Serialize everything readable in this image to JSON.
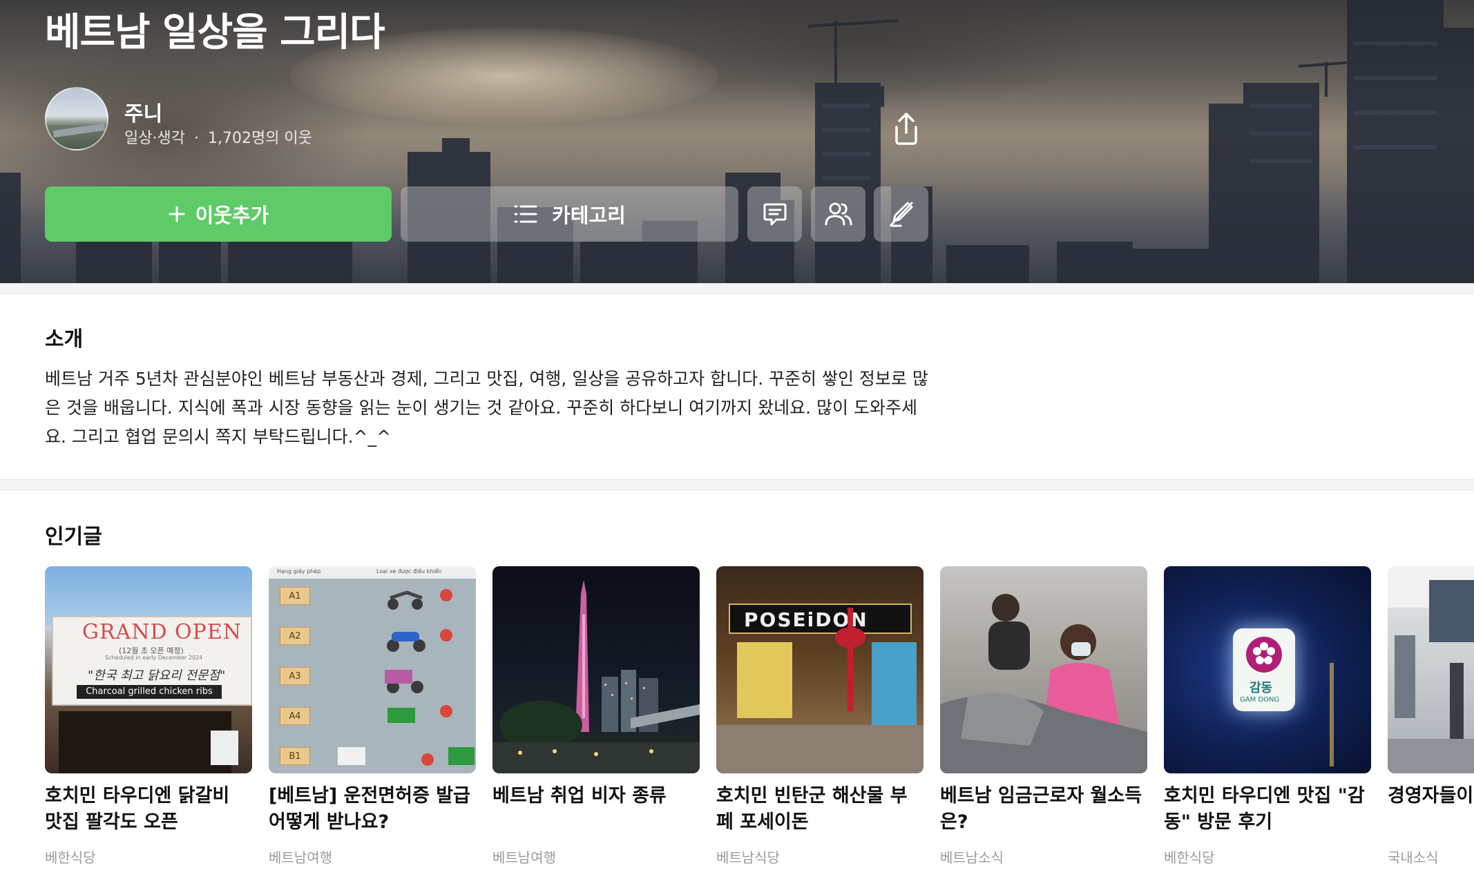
{
  "blog": {
    "title": "베트남 일상을 그리다",
    "nickname": "주니",
    "category": "일상·생각",
    "neighbors": "1,702명의 이웃",
    "meta_sep": "·"
  },
  "actions": {
    "add_neighbor_label": "이웃추가",
    "category_label": "카테고리"
  },
  "intro": {
    "heading": "소개",
    "text": "베트남 거주 5년차 관심분야인 베트남 부동산과 경제, 그리고 맛집, 여행, 일상을 공유하고자 합니다. 꾸준히 쌓인 정보로 많은 것을 배웁니다. 지식에 폭과 시장 동향을 읽는 눈이 생기는 것 같아요. 꾸준히 하다보니 여기까지 왔네요. 많이 도와주세요. 그리고 협업 문의시 쪽지 부탁드립니다.^_^"
  },
  "popular": {
    "heading": "인기글",
    "posts": [
      {
        "title": "호치민 타우디엔 닭갈비 맛집 팔각도 오픈",
        "category": "베한식당",
        "thumb": {
          "banner_main": "GRAND OPEN",
          "banner_sub": "(12월 초 오픈 예정)",
          "banner_sub2": "Scheduled in early December 2024",
          "banner_kr": "\"한국 최고 닭요리 전문점\"",
          "banner_en": "Charcoal grilled chicken ribs"
        }
      },
      {
        "title": "[베트남] 운전면허증 발급 어떻게 받나요?",
        "category": "베트남여행",
        "thumb": {
          "col1": "Hạng giấy phép",
          "col2": "Loại xe được điều khiển",
          "classes": [
            "A1",
            "A2",
            "A3",
            "A4",
            "B1"
          ]
        }
      },
      {
        "title": "베트남 취업 비자 종류",
        "category": "베트남여행"
      },
      {
        "title": "호치민 빈탄군 해산물 부페 포세이돈",
        "category": "베트남식당",
        "thumb": {
          "sign": "POSEiDON"
        }
      },
      {
        "title": "베트남 임금근로자 월소득은?",
        "category": "베트남소식"
      },
      {
        "title": "호치민 타우디엔 맛집 \"감동\" 방문 후기",
        "category": "베한식당",
        "thumb": {
          "sign_kr": "감동",
          "sign_en": "GAM DONG"
        }
      },
      {
        "title": "경영자들이 똑똑하면 해",
        "category": "국내소식"
      }
    ]
  },
  "colors": {
    "accent_green": "#5fcb68",
    "muted_text": "#9b9b9b",
    "divider": "#f4f4f5"
  }
}
